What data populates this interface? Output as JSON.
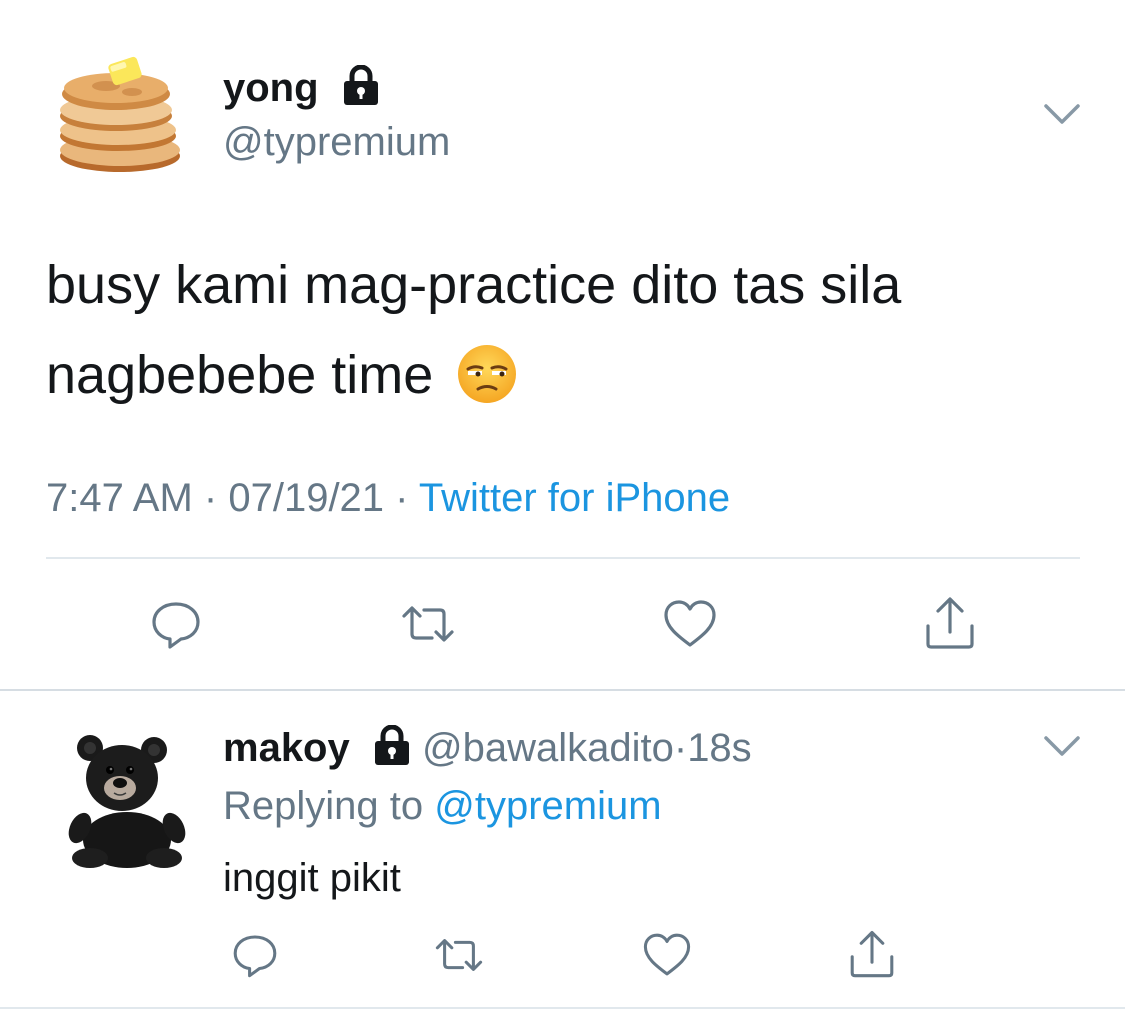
{
  "tweet": {
    "display_name": "yong",
    "handle": "@typremium",
    "text": "busy kami mag-practice dito tas sila nagbebebe time",
    "emoji": "unamused-face",
    "time": "7:47 AM",
    "date": "07/19/21",
    "source": "Twitter for iPhone",
    "separator": "·",
    "avatar": "pancakes-icon",
    "verified_lock": "lock-icon"
  },
  "reply": {
    "display_name": "makoy",
    "handle": "@bawalkadito",
    "separator": "·",
    "age": "18s",
    "replying_prefix": "Replying to",
    "replying_to": "@typremium",
    "text": "inggit pikit",
    "avatar": "black-teddy-bear-icon"
  },
  "actions": [
    "reply-icon",
    "retweet-icon",
    "like-icon",
    "share-icon"
  ],
  "colors": {
    "text": "#14171a",
    "secondary": "#657786",
    "link": "#1b95e0",
    "divider": "#e1e8ed"
  }
}
